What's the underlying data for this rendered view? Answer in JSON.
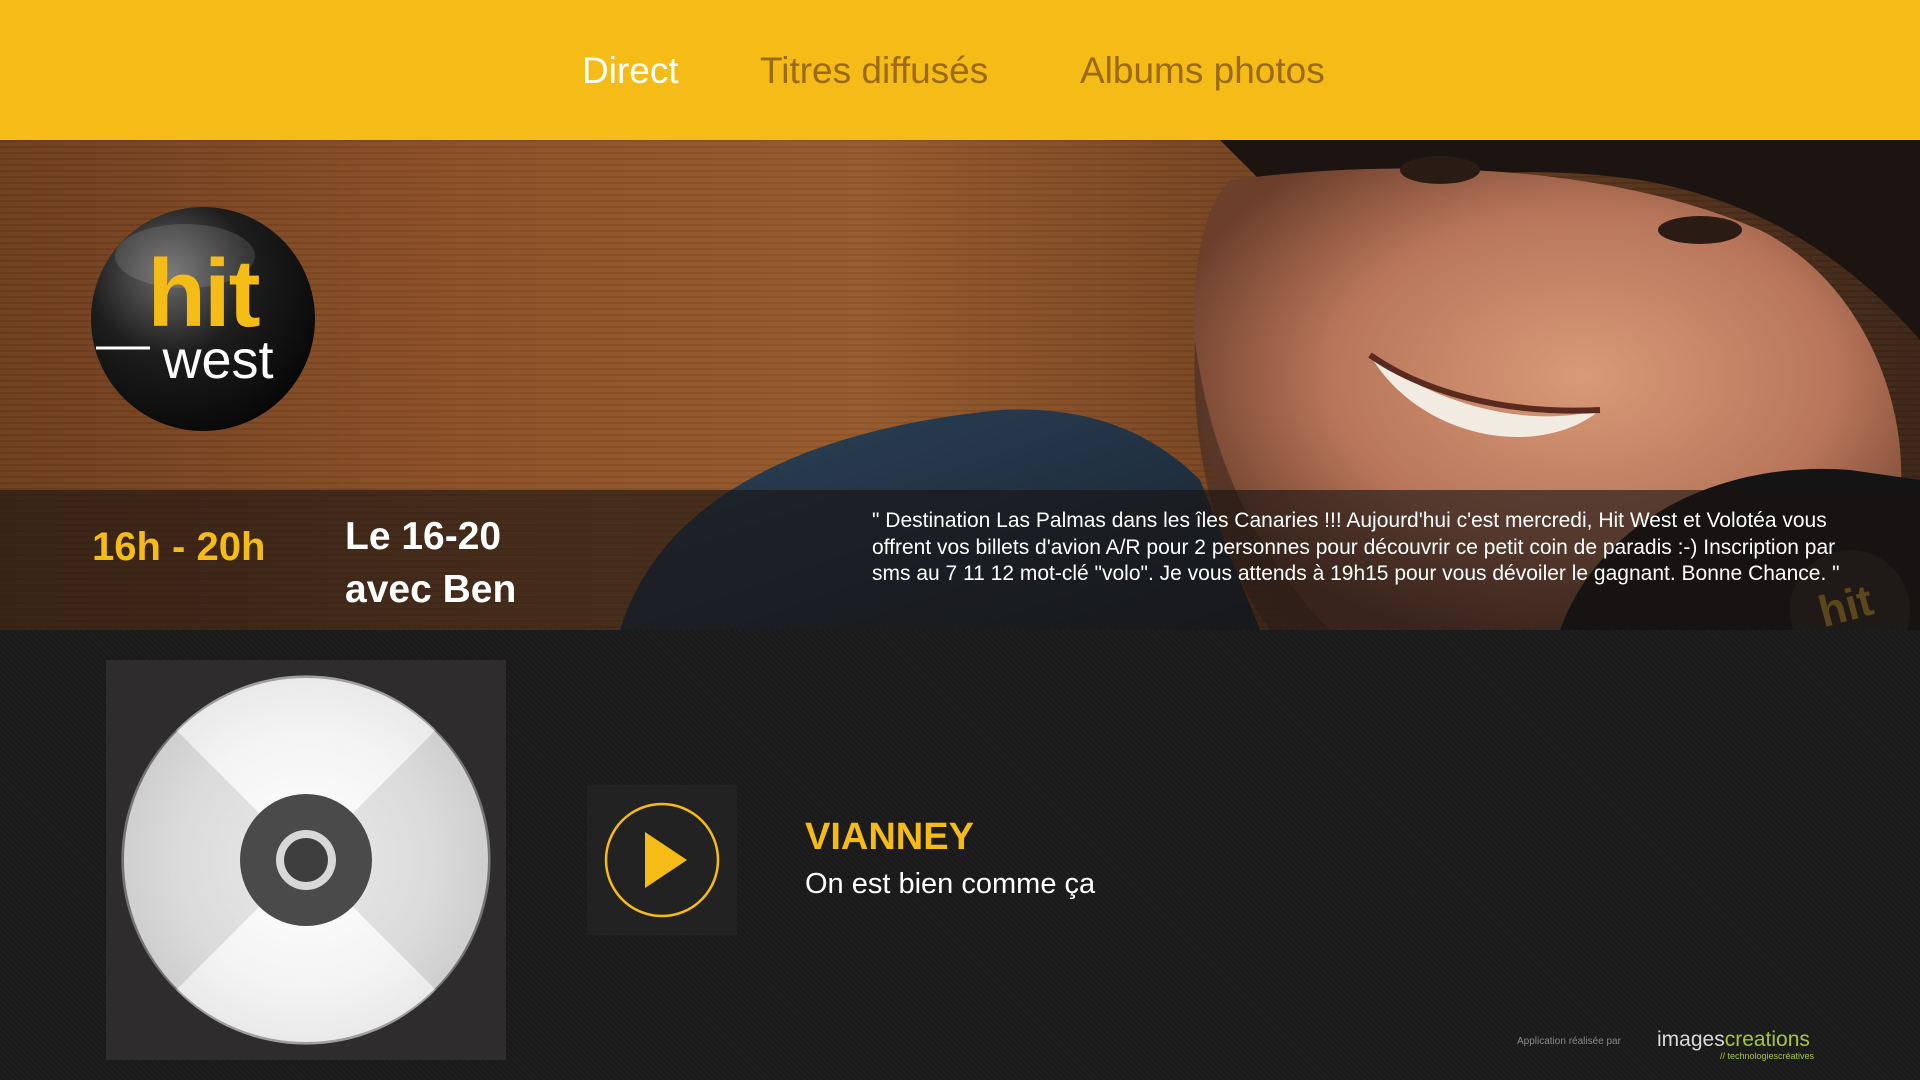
{
  "nav": {
    "tabs": [
      {
        "label": "Direct",
        "active": true
      },
      {
        "label": "Titres diffusés",
        "active": false
      },
      {
        "label": "Albums photos",
        "active": false
      }
    ]
  },
  "brand": {
    "logo_top": "hit",
    "logo_bottom": "west",
    "accent_color": "#f5bb17"
  },
  "show": {
    "time": "16h - 20h",
    "name_line1": "Le 16-20",
    "name_line2": "avec Ben",
    "description": "\" Destination Las Palmas dans les îles Canaries !!! Aujourd'hui c'est mercredi, Hit West et Volotéa vous offrent vos billets d'avion A/R pour 2 personnes pour découvrir ce petit coin de paradis :-) Inscription par sms au 7 11 12 mot-clé \"volo\". Je vous attends à 19h15 pour vous dévoiler le gagnant. Bonne Chance. \""
  },
  "now_playing": {
    "artist": "VIANNEY",
    "title": "On est bien comme ça",
    "cover_icon": "cd-icon",
    "play_icon": "play-icon"
  },
  "credit": {
    "label": "Application réalisée par",
    "brand_part1": "images",
    "brand_part2": "creations",
    "tagline": "// technologiescréatives"
  }
}
